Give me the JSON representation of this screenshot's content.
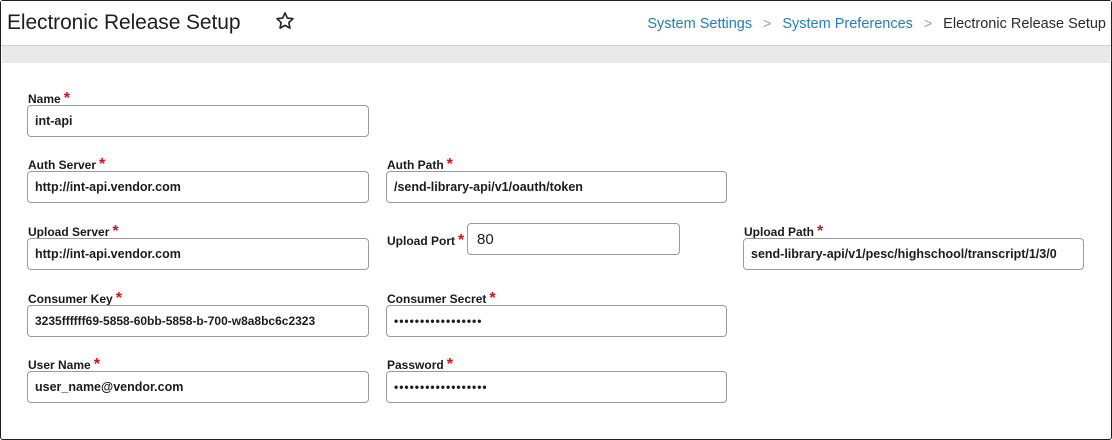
{
  "header": {
    "title": "Electronic Release Setup",
    "star_icon": "star-outline-icon",
    "breadcrumb": {
      "items": [
        "System Settings",
        "System Preferences",
        "Electronic Release Setup"
      ],
      "separator": ">"
    }
  },
  "form": {
    "name": {
      "label": "Name",
      "required": "*",
      "value": "int-api"
    },
    "auth_server": {
      "label": "Auth Server",
      "required": "*",
      "value": "http://int-api.vendor.com"
    },
    "auth_path": {
      "label": "Auth Path",
      "required": "*",
      "value": "/send-library-api/v1/oauth/token"
    },
    "upload_server": {
      "label": "Upload Server",
      "required": "*",
      "value": "http://int-api.vendor.com"
    },
    "upload_port": {
      "label": "Upload Port",
      "required": "*",
      "value": "80"
    },
    "upload_path": {
      "label": "Upload Path",
      "required": "*",
      "value": "send-library-api/v1/pesc/highschool/transcript/1/3/0"
    },
    "consumer_key": {
      "label": "Consumer Key",
      "required": "*",
      "value": "3235ffffff69-5858-60bb-5858-b-700-w8a8bc6c2323"
    },
    "consumer_secret": {
      "label": "Consumer Secret",
      "required": "*",
      "value": "•••••••••••••••••"
    },
    "user_name": {
      "label": "User Name",
      "required": "*",
      "value": "user_name@vendor.com"
    },
    "password": {
      "label": "Password",
      "required": "*",
      "value": "••••••••••••••••••"
    }
  },
  "colors": {
    "link": "#1f7ec4",
    "required": "#d0141a",
    "band": "#e9e9e9"
  }
}
